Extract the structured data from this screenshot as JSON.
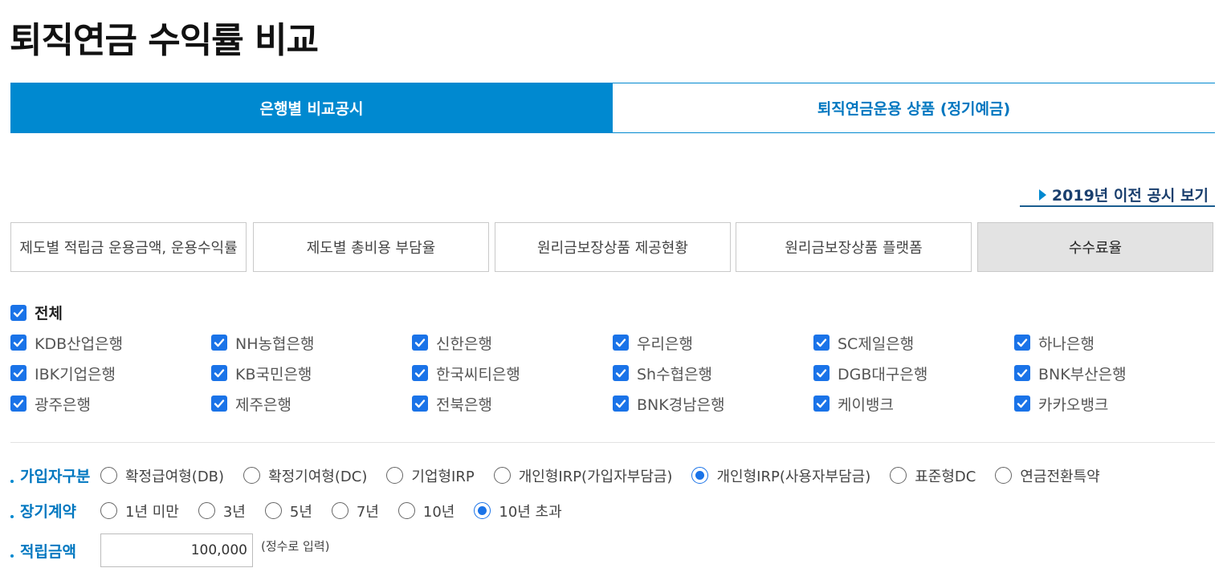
{
  "page_title": "퇴직연금 수익률 비교",
  "main_tabs": [
    {
      "label": "은행별 비교공시",
      "active": true
    },
    {
      "label": "퇴직연금운용 상품 (정기예금)",
      "active": false
    }
  ],
  "prev_link": "2019년 이전 공시 보기",
  "sub_tabs": [
    {
      "label": "제도별 적립금 운용금액, 운용수익률"
    },
    {
      "label": "제도별 총비용 부담율"
    },
    {
      "label": "원리금보장상품 제공현황"
    },
    {
      "label": "원리금보장상품 플랫폼"
    },
    {
      "label": "수수료율",
      "selected": true
    }
  ],
  "banks": {
    "all_label": "전체",
    "rows": [
      [
        "KDB산업은행",
        "NH농협은행",
        "신한은행",
        "우리은행",
        "SC제일은행",
        "하나은행"
      ],
      [
        "IBK기업은행",
        "KB국민은행",
        "한국씨티은행",
        "Sh수협은행",
        "DGB대구은행",
        "BNK부산은행"
      ],
      [
        "광주은행",
        "제주은행",
        "전북은행",
        "BNK경남은행",
        "케이뱅크",
        "카카오뱅크"
      ]
    ]
  },
  "subscriber": {
    "label": "가입자구분",
    "options": [
      "확정급여형(DB)",
      "확정기여형(DC)",
      "기업형IRP",
      "개인형IRP(가입자부담금)",
      "개인형IRP(사용자부담금)",
      "표준형DC",
      "연금전환특약"
    ],
    "selected_index": 4
  },
  "long_term": {
    "label": "장기계약",
    "options": [
      "1년 미만",
      "3년",
      "5년",
      "7년",
      "10년",
      "10년 초과"
    ],
    "selected_index": 5
  },
  "amount": {
    "label": "적립금액",
    "value": "100,000",
    "note": "(정수로 입력)"
  },
  "colors": {
    "accent": "#0089d0",
    "checkbox": "#1a73e8",
    "selected_subtab": "#e3e3e3"
  }
}
